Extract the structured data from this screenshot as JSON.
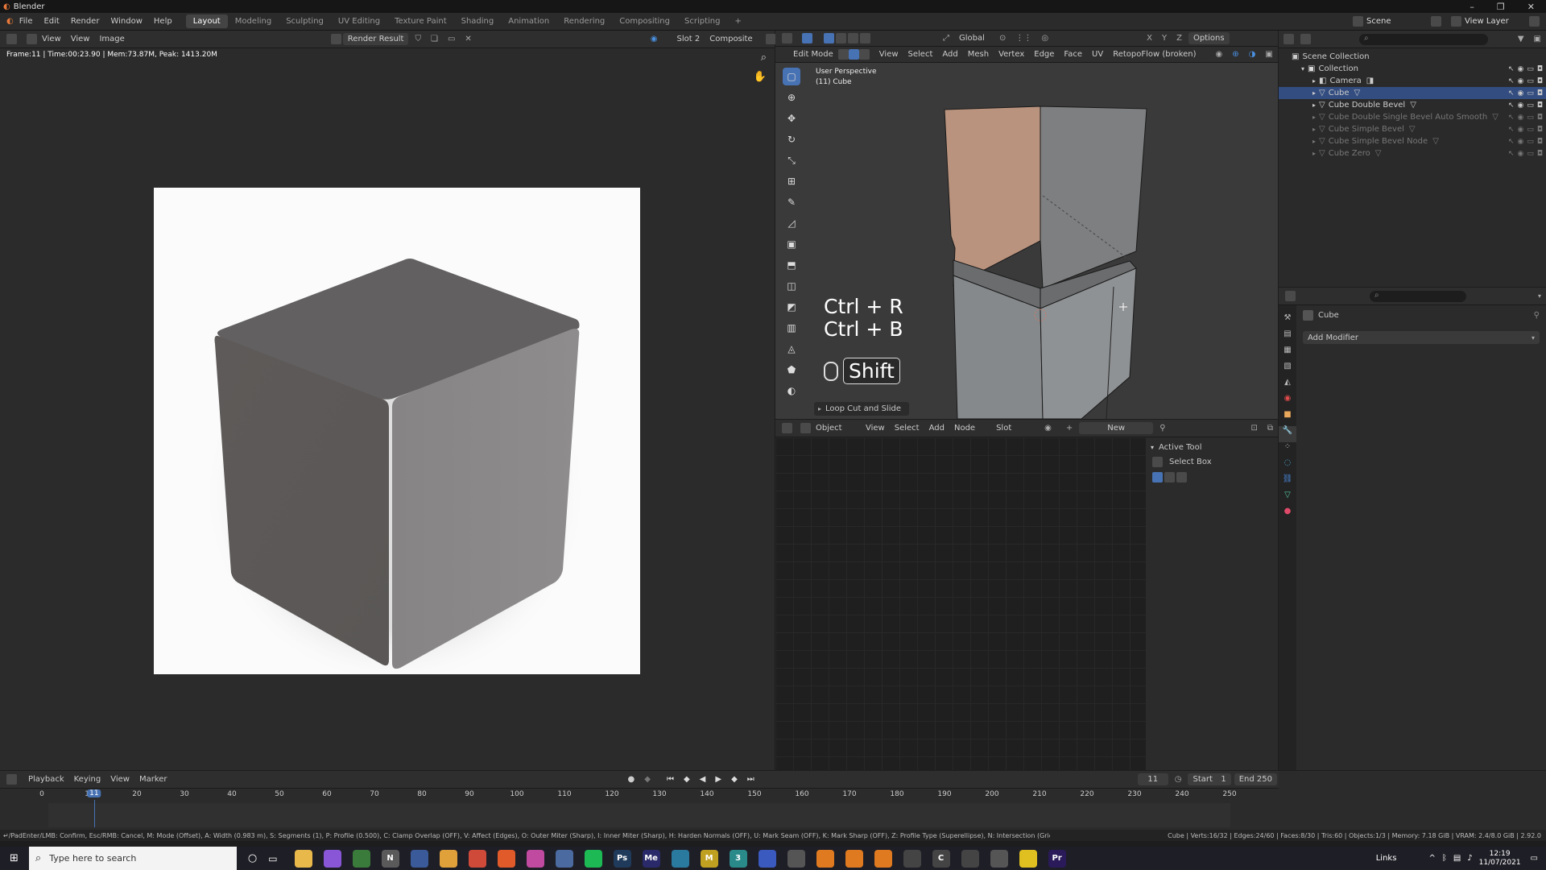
{
  "window": {
    "title": "Blender"
  },
  "menu": [
    "File",
    "Edit",
    "Render",
    "Window",
    "Help"
  ],
  "workspaces": [
    "Layout",
    "Modeling",
    "Sculpting",
    "UV Editing",
    "Texture Paint",
    "Shading",
    "Animation",
    "Rendering",
    "Compositing",
    "Scripting",
    "+"
  ],
  "topright": {
    "scene": "Scene",
    "view_layer": "View Layer"
  },
  "image_editor": {
    "menus": [
      "View",
      "View",
      "Image"
    ],
    "image": "Render Result",
    "slot": "Slot 2",
    "composite": "Composite",
    "info": "Frame:11 | Time:00:23.90 | Mem:73.87M, Peak: 1413.20M"
  },
  "viewport": {
    "mode": "Edit Mode",
    "menus": [
      "View",
      "Select",
      "Add",
      "Mesh",
      "Vertex",
      "Edge",
      "Face",
      "UV"
    ],
    "retopo": "RetopoFlow (broken)",
    "orientation": "Global",
    "options": "Options",
    "perspective": "User Perspective",
    "object": "(11) Cube",
    "key1": "Ctrl + R",
    "key2": "Ctrl + B",
    "key3": "Shift",
    "last_op": "Loop Cut and Slide"
  },
  "node_editor": {
    "mode": "Object",
    "menus": [
      "View",
      "Select",
      "Add",
      "Node"
    ],
    "slot": "Slot",
    "new_label": "New",
    "active_tool_title": "Active Tool",
    "tool_name": "Select Box"
  },
  "outliner": {
    "title": "Scene Collection",
    "items": [
      {
        "name": "Collection",
        "level": 1,
        "open": true,
        "state": "normal"
      },
      {
        "name": "Camera",
        "level": 2,
        "state": "normal",
        "icon": "camera"
      },
      {
        "name": "Cube",
        "level": 2,
        "state": "selected",
        "icon": "mesh"
      },
      {
        "name": "Cube Double Bevel",
        "level": 2,
        "state": "normal",
        "icon": "mesh"
      },
      {
        "name": "Cube Double Single Bevel Auto Smooth",
        "level": 2,
        "state": "dim",
        "icon": "mesh"
      },
      {
        "name": "Cube Simple Bevel",
        "level": 2,
        "state": "dim",
        "icon": "mesh"
      },
      {
        "name": "Cube Simple Bevel Node",
        "level": 2,
        "state": "dim",
        "icon": "mesh"
      },
      {
        "name": "Cube Zero",
        "level": 2,
        "state": "dim",
        "icon": "mesh"
      }
    ]
  },
  "properties": {
    "object": "Cube",
    "add_modifier": "Add Modifier"
  },
  "timeline": {
    "menus": [
      "Playback",
      "Keying",
      "View",
      "Marker"
    ],
    "current": "11",
    "start_label": "Start",
    "start": "1",
    "end_label": "End",
    "end": "250",
    "ticks": [
      "0",
      "10",
      "20",
      "30",
      "40",
      "50",
      "60",
      "70",
      "80",
      "90",
      "100",
      "110",
      "120",
      "130",
      "140",
      "150",
      "160",
      "170",
      "180",
      "190",
      "200",
      "210",
      "220",
      "230",
      "240",
      "250"
    ]
  },
  "statusbar": {
    "left": "↵/PadEnter/LMB: Confirm, Esc/RMB: Cancel, M: Mode (Offset), A: Width (0.983 m), S: Segments (1), P: Profile (0.500), C: Clamp Overlap (OFF), V: Affect (Edges), O: Outer Miter (Sharp), I: Inner Miter (Sharp), H: Harden Normals (OFF), U: Mark Seam (OFF), K: Mark Sharp (OFF), Z: Profile Type (Superellipse), N: Intersection (Grid Fill)",
    "right": "Cube | Verts:16/32 | Edges:24/60 | Faces:8/30 | Tris:60 | Objects:1/3 | Memory: 7.18 GiB | VRAM: 2.4/8.0 GiB | 2.92.0"
  },
  "taskbar": {
    "search_placeholder": "Type here to search",
    "links": "Links",
    "time": "12:19",
    "date": "11/07/2021",
    "apps": [
      {
        "label": "",
        "color": "#e8b84a"
      },
      {
        "label": "",
        "color": "#8a56d8"
      },
      {
        "label": "",
        "color": "#3a7a3a"
      },
      {
        "label": "N",
        "color": "#5a5a5a"
      },
      {
        "label": "",
        "color": "#3a5a9a"
      },
      {
        "label": "",
        "color": "#e0a03a"
      },
      {
        "label": "",
        "color": "#d04a3a"
      },
      {
        "label": "",
        "color": "#e05a2a"
      },
      {
        "label": "",
        "color": "#c04aa0"
      },
      {
        "label": "",
        "color": "#4a6aa0"
      },
      {
        "label": "",
        "color": "#1db954"
      },
      {
        "label": "Ps",
        "color": "#1f3a5a"
      },
      {
        "label": "Me",
        "color": "#2a2a6a"
      },
      {
        "label": "",
        "color": "#2a7aa0"
      },
      {
        "label": "M",
        "color": "#c0a020"
      },
      {
        "label": "3",
        "color": "#2a8a8a"
      },
      {
        "label": "",
        "color": "#3a5ac0"
      },
      {
        "label": "",
        "color": "#555"
      },
      {
        "label": "",
        "color": "#e07a20"
      },
      {
        "label": "",
        "color": "#e07a20"
      },
      {
        "label": "",
        "color": "#e07a20"
      },
      {
        "label": "",
        "color": "#444"
      },
      {
        "label": "C",
        "color": "#444"
      },
      {
        "label": "",
        "color": "#444"
      },
      {
        "label": "",
        "color": "#555"
      },
      {
        "label": "",
        "color": "#e0c020"
      },
      {
        "label": "Pr",
        "color": "#2a1a5a"
      }
    ]
  }
}
